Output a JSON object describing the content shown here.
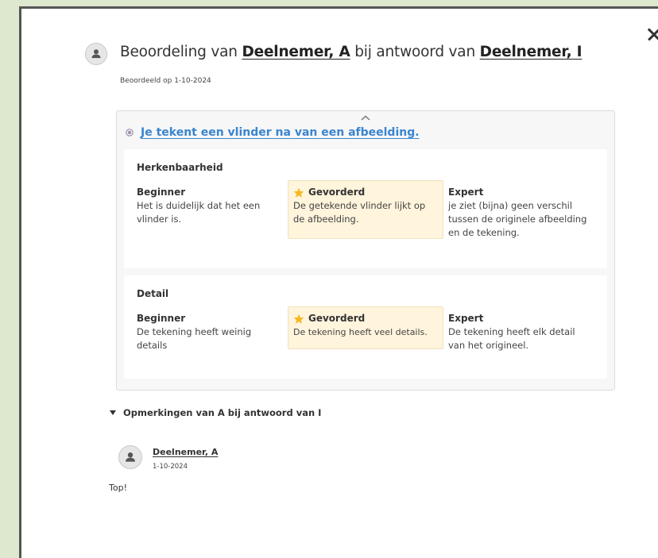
{
  "window": {
    "close_label": "Sluiten"
  },
  "header": {
    "title_prefix": "Beoordeling van",
    "assessed_name": "Deelnemer, A",
    "title_middle": "bij antwoord van",
    "answer_name": "Deelnemer, I",
    "assessed_on": "Beoordeeld op 1-10-2024"
  },
  "rubric": {
    "goal": "Je tekent een vlinder na van een afbeelding.",
    "criteria": [
      {
        "name": "Herkenbaarheid",
        "levels": [
          {
            "title": "Beginner",
            "description": "Het is duidelijk dat het een vlinder is.",
            "selected": false
          },
          {
            "title": "Gevorderd",
            "description": "De getekende vlinder lijkt op de afbeelding.",
            "selected": true
          },
          {
            "title": "Expert",
            "description": "je ziet (bijna) geen verschil tussen de originele afbeelding en de tekening.",
            "selected": false
          }
        ]
      },
      {
        "name": "Detail",
        "levels": [
          {
            "title": "Beginner",
            "description": "De tekening heeft weinig details",
            "selected": false
          },
          {
            "title": "Gevorderd",
            "description": "De tekening heeft veel details.",
            "selected": true
          },
          {
            "title": "Expert",
            "description": "De tekening heeft elk detail van het origineel.",
            "selected": false
          }
        ]
      }
    ]
  },
  "comments": {
    "toggle_label": "Opmerkingen van A bij antwoord van I",
    "items": [
      {
        "author": "Deelnemer, A",
        "date": "1-10-2024",
        "text": "Top!"
      }
    ]
  },
  "icons": {
    "avatar": "user-avatar-icon",
    "close": "close-icon",
    "collapse": "chevron-up-icon",
    "goal": "goal-dot-icon",
    "selected_level": "star-icon",
    "toggle": "caret-down-icon"
  },
  "colors": {
    "page_background": "#dde8cf",
    "link": "#3a85d0",
    "selected_level_background": "#fff4dc",
    "star": "#f5b921"
  }
}
